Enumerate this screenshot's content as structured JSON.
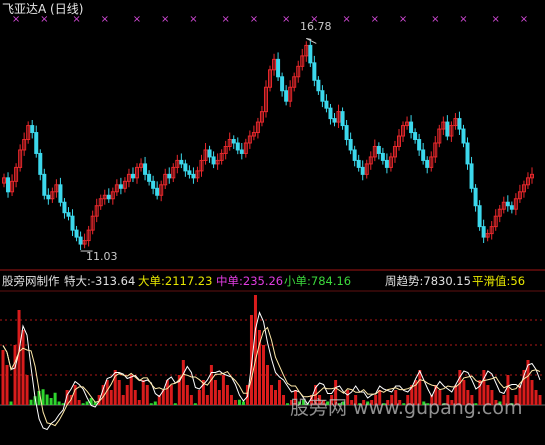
{
  "header": {
    "title": "飞亚达A (日线)"
  },
  "price_panel": {
    "high_marker": "16.78",
    "low_marker": "11.03"
  },
  "indicator_bar": {
    "name": "股旁网制作",
    "tedada": "特大:-313.64",
    "dadan": "大单:2117.23",
    "zhongdan": "中单:235.26",
    "xiaodan": "小单:784.16",
    "zhouqushi": "周趋势:7830.15",
    "pinghua": "平滑值:56"
  },
  "watermark": "股旁网 www.gupang.com",
  "colors": {
    "background": "#000000",
    "up_candle": "#e8282c",
    "down_candle": "#3cd8ec",
    "signal_mark": "#d34bd8",
    "pos_bar": "#d91c1c",
    "neg_bar": "#2ed52e",
    "grid": "#b01818",
    "zhongdan": "#e03ce0",
    "xiaodan": "#3cd83c",
    "pinghua": "#e8e800"
  },
  "chart_data": [
    {
      "type": "candlestick",
      "title": "飞亚达A (日线)",
      "annotations": [
        {
          "label": "16.78",
          "value": 16.78,
          "kind": "period-high"
        },
        {
          "label": "11.03",
          "value": 11.03,
          "kind": "period-low"
        }
      ],
      "ylim": [
        10.7,
        17.3
      ],
      "close_series": [
        13.0,
        12.6,
        12.9,
        13.3,
        13.8,
        14.1,
        14.5,
        14.3,
        13.7,
        13.1,
        12.5,
        12.4,
        12.6,
        12.8,
        12.3,
        12.0,
        11.9,
        11.5,
        11.3,
        11.1,
        11.2,
        11.5,
        11.9,
        12.2,
        12.4,
        12.5,
        12.4,
        12.6,
        12.8,
        12.7,
        12.9,
        13.1,
        13.0,
        13.3,
        13.4,
        13.1,
        12.9,
        12.7,
        12.5,
        12.8,
        13.1,
        13.0,
        13.3,
        13.5,
        13.4,
        13.2,
        13.1,
        13.0,
        13.2,
        13.5,
        13.8,
        13.6,
        13.4,
        13.5,
        13.7,
        13.9,
        14.1,
        14.0,
        13.8,
        13.7,
        14.0,
        14.2,
        14.3,
        14.6,
        14.9,
        15.6,
        16.1,
        16.4,
        15.9,
        15.5,
        15.2,
        15.6,
        15.9,
        16.2,
        16.5,
        16.8,
        16.3,
        15.8,
        15.5,
        15.2,
        15.0,
        14.7,
        14.6,
        14.9,
        14.5,
        14.1,
        13.8,
        13.5,
        13.3,
        13.1,
        13.4,
        13.6,
        13.9,
        13.7,
        13.5,
        13.3,
        13.6,
        13.9,
        14.2,
        14.5,
        14.6,
        14.3,
        14.1,
        13.8,
        13.5,
        13.3,
        13.6,
        14.0,
        14.4,
        14.6,
        14.2,
        14.5,
        14.7,
        14.4,
        14.0,
        13.4,
        12.7,
        12.2,
        11.6,
        11.3,
        11.4,
        11.6,
        11.9,
        12.1,
        12.3,
        12.2,
        12.1,
        12.4,
        12.6,
        12.8,
        13.0,
        13.1
      ],
      "signals_count": 18
    },
    {
      "type": "bar",
      "title": "股旁网制作",
      "series": [
        {
          "name": "特大",
          "last": -313.64
        },
        {
          "name": "大单",
          "last": 2117.23
        },
        {
          "name": "中单",
          "last": 235.26
        },
        {
          "name": "小单",
          "last": 784.16
        },
        {
          "name": "周趋势",
          "last": 7830.15
        },
        {
          "name": "平滑值",
          "last": 56
        }
      ],
      "values": [
        55,
        40,
        -10,
        60,
        95,
        75,
        30,
        -15,
        -25,
        -40,
        -45,
        -30,
        -20,
        -35,
        -10,
        -5,
        15,
        10,
        20,
        5,
        -5,
        -10,
        -20,
        -10,
        10,
        20,
        25,
        15,
        35,
        25,
        10,
        20,
        30,
        15,
        5,
        25,
        20,
        -5,
        -10,
        10,
        15,
        25,
        20,
        -5,
        30,
        45,
        20,
        10,
        -5,
        15,
        25,
        10,
        40,
        25,
        15,
        30,
        20,
        10,
        5,
        -15,
        -10,
        20,
        90,
        110,
        75,
        60,
        40,
        20,
        15,
        25,
        10,
        -5,
        5,
        15,
        -10,
        -15,
        -5,
        10,
        20,
        10,
        5,
        -10,
        10,
        25,
        -5,
        -10,
        15,
        5,
        10,
        -5,
        5,
        -10,
        5,
        10,
        15,
        -5,
        5,
        10,
        15,
        5,
        -5,
        10,
        20,
        25,
        35,
        -10,
        -5,
        10,
        20,
        15,
        -5,
        10,
        5,
        20,
        35,
        25,
        15,
        10,
        -5,
        25,
        35,
        20,
        15,
        5,
        -10,
        10,
        30,
        -5,
        10,
        20,
        35,
        45,
        25,
        15,
        10
      ]
    }
  ]
}
